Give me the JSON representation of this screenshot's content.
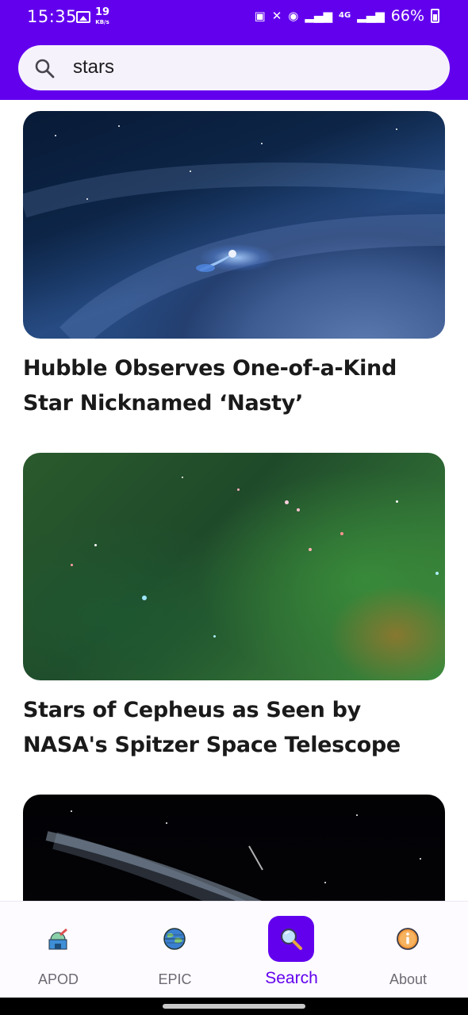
{
  "status_bar": {
    "time": "15:35",
    "network_speed_value": "19",
    "network_speed_unit": "KB/s",
    "network_type": "4G",
    "battery": "66%"
  },
  "search": {
    "query": "stars",
    "icon": "search-icon"
  },
  "results": [
    {
      "title": "Hubble Observes One-of-a-Kind Star Nicknamed ‘Nasty’",
      "image": "nebula-star-image"
    },
    {
      "title": "Stars of Cepheus as Seen by NASA's Spitzer Space Telescope",
      "image": "cepheus-stars-image"
    },
    {
      "title": "",
      "image": "comet-image"
    }
  ],
  "bottom_nav": {
    "items": [
      {
        "label": "APOD",
        "icon": "observatory-icon",
        "active": false
      },
      {
        "label": "EPIC",
        "icon": "earth-icon",
        "active": false
      },
      {
        "label": "Search",
        "icon": "magnifier-icon",
        "active": true
      },
      {
        "label": "About",
        "icon": "info-icon",
        "active": false
      }
    ]
  },
  "colors": {
    "primary": "#6200ee",
    "search_background": "#f6f2fb",
    "nav_inactive_label": "#6e6a73"
  }
}
